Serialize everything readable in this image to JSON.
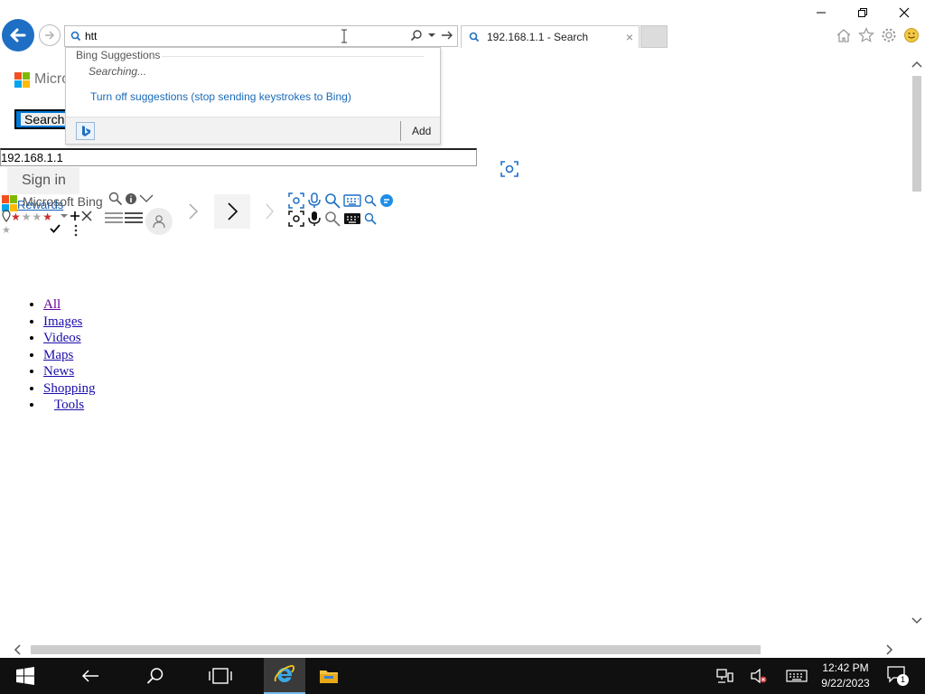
{
  "browser": {
    "address_text": "htt",
    "tab_title": "192.168.1.1 - Search",
    "tab_close": "×"
  },
  "suggestions": {
    "header": "Bing Suggestions",
    "status": "Searching...",
    "turn_off": "Turn off suggestions (stop sending keystrokes to Bing)",
    "add_label": "Add"
  },
  "page": {
    "logo_text": "Microsoft",
    "search_button": "Search",
    "query_value": "192.168.1.1",
    "sign_in": "Sign in",
    "rewards": "Rewards",
    "bing_brand": "Microsoft Bing",
    "nav": [
      {
        "label": "All"
      },
      {
        "label": "Images"
      },
      {
        "label": "Videos"
      },
      {
        "label": "Maps"
      },
      {
        "label": "News"
      },
      {
        "label": "Shopping"
      },
      {
        "label": "Tools"
      }
    ]
  },
  "taskbar": {
    "time": "12:42 PM",
    "date": "9/22/2023",
    "notification_count": "1"
  },
  "colors": {
    "accent": "#1e6fc4",
    "link": "#1a0dab",
    "visited_link": "#660099",
    "taskbar": "#101010"
  }
}
